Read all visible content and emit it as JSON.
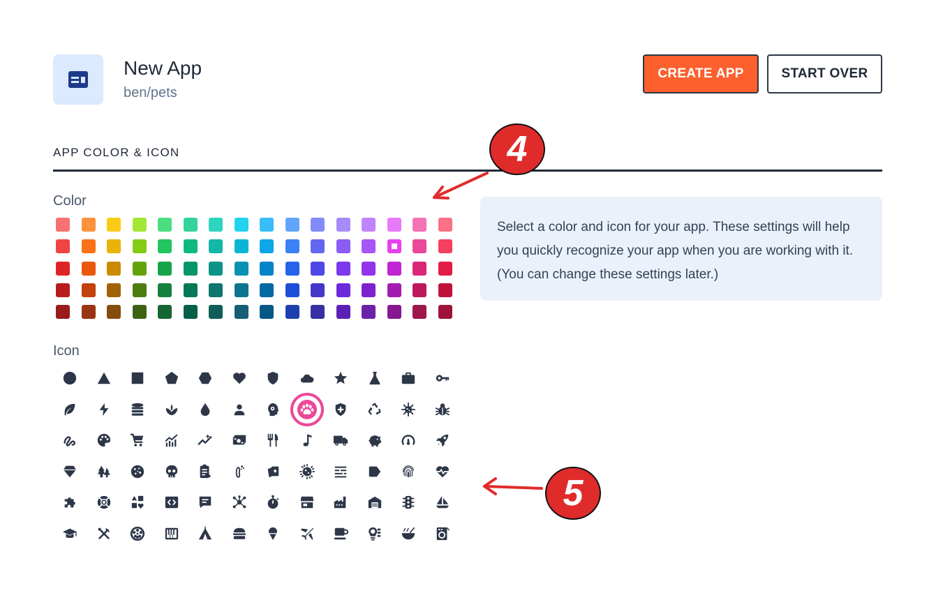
{
  "header": {
    "app_name": "New App",
    "app_path": "ben/pets",
    "app_icon": "app-window-icon",
    "app_icon_color": "#1e3a8a",
    "app_icon_bg": "#dbeafe",
    "create_label": "CREATE APP",
    "start_over_label": "START OVER",
    "create_color": "#fd5f2d"
  },
  "section": {
    "heading": "APP COLOR & ICON",
    "color_label": "Color",
    "icon_label": "Icon",
    "info_text": "Select a color and icon for your app. These settings will help you quickly recognize your app when you are working with it. (You can change these settings later.)"
  },
  "colors": {
    "selected": "#e542ed",
    "rows": [
      [
        "#f87171",
        "#fb923c",
        "#facc15",
        "#a3e635",
        "#4ade80",
        "#34d399",
        "#2dd4bf",
        "#22d3ee",
        "#38bdf8",
        "#60a5fa",
        "#818cf8",
        "#a78bfa",
        "#c084fc",
        "#e879f9",
        "#f472b6",
        "#fb7185"
      ],
      [
        "#ef4444",
        "#f97316",
        "#eab308",
        "#84cc16",
        "#22c55e",
        "#10b981",
        "#14b8a6",
        "#06b6d4",
        "#0ea5e9",
        "#3b82f6",
        "#6366f1",
        "#8b5cf6",
        "#a855f7",
        "#e542ed",
        "#ec4899",
        "#f43f5e"
      ],
      [
        "#dc2626",
        "#ea580c",
        "#ca8a04",
        "#65a30d",
        "#16a34a",
        "#059669",
        "#0d9488",
        "#0891b2",
        "#0284c7",
        "#2563eb",
        "#4f46e5",
        "#7c3aed",
        "#9333ea",
        "#c026d3",
        "#db2777",
        "#e11d48"
      ],
      [
        "#b91c1c",
        "#c2410c",
        "#a16207",
        "#4d7c0f",
        "#15803d",
        "#047857",
        "#0f766e",
        "#0e7490",
        "#0369a1",
        "#1d4ed8",
        "#4338ca",
        "#6d28d9",
        "#7e22ce",
        "#a21caf",
        "#be185d",
        "#be123c"
      ],
      [
        "#991b1b",
        "#9a3412",
        "#854d0e",
        "#3f6212",
        "#166534",
        "#065f46",
        "#115e59",
        "#155e75",
        "#075985",
        "#1e40af",
        "#3730a3",
        "#5b21b6",
        "#6b21a8",
        "#86198f",
        "#9d174d",
        "#9f1239"
      ]
    ]
  },
  "icons": {
    "selected": "paw-icon",
    "icon_color": "#2d3748",
    "selected_color": "#ec4899",
    "rows": [
      [
        "circle-icon",
        "triangle-icon",
        "square-icon",
        "pentagon-icon",
        "hexagon-icon",
        "heart-icon",
        "shield-icon",
        "cloud-icon",
        "star-icon",
        "flask-icon",
        "briefcase-icon",
        "key-icon"
      ],
      [
        "leaf-icon",
        "bolt-icon",
        "database-icon",
        "plant-icon",
        "water-drop-icon",
        "person-icon",
        "brain-icon",
        "paw-icon",
        "shield-plus-icon",
        "recycle-icon",
        "virus-icon",
        "bug-icon"
      ],
      [
        "squiggle-icon",
        "palette-icon",
        "cart-icon",
        "chart-icon",
        "trend-icon",
        "money-icon",
        "utensils-icon",
        "music-icon",
        "truck-icon",
        "piggy-bank-icon",
        "gauge-icon",
        "rocket-icon"
      ],
      [
        "diamond-icon",
        "trees-icon",
        "cookie-icon",
        "skull-icon",
        "clipboard-icon",
        "footprint-icon",
        "cards-icon",
        "microbe-icon",
        "list-icon",
        "tag-icon",
        "fingerprint-icon",
        "heartbeat-icon"
      ],
      [
        "puzzle-icon",
        "lifebuoy-icon",
        "shapes-icon",
        "code-icon",
        "comment-icon",
        "network-icon",
        "stopwatch-icon",
        "store-icon",
        "factory-icon",
        "warehouse-icon",
        "traffic-light-icon",
        "sailboat-icon"
      ],
      [
        "graduation-cap-icon",
        "tools-icon",
        "film-reel-icon",
        "piano-icon",
        "tent-icon",
        "burger-icon",
        "ice-cream-icon",
        "airplane-icon",
        "coffee-icon",
        "lightbulb-icon",
        "bowl-icon",
        "laundry-icon"
      ]
    ]
  },
  "annotations": {
    "step_4": "4",
    "step_5": "5",
    "color": "#e02b2b"
  }
}
